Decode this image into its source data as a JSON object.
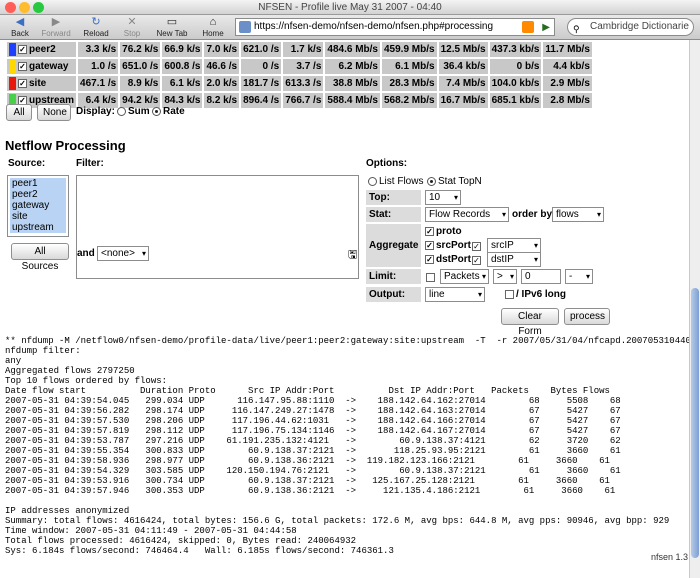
{
  "window": {
    "title": "NFSEN - Profile live May 31 2007 - 04:40"
  },
  "toolbar": {
    "back": "Back",
    "forward": "Forward",
    "reload": "Reload",
    "stop": "Stop",
    "new_tab": "New Tab",
    "home": "Home",
    "url": "https://nfsen-demo/nfsen-demo/nfsen.php#processing",
    "search_placeholder": "Cambridge Dictionarie"
  },
  "stats": [
    {
      "name": "peer2",
      "color": "#1f3fff",
      "checked": true,
      "values": [
        "3.3 k/s",
        "76.2 k/s",
        "66.9 k/s",
        "7.0 k/s",
        "621.0 /s",
        "1.7 k/s",
        "484.6 Mb/s",
        "459.9 Mb/s",
        "12.5 Mb/s",
        "437.3 kb/s",
        "11.7 Mb/s"
      ]
    },
    {
      "name": "gateway",
      "color": "#ffd800",
      "checked": true,
      "values": [
        "1.0 /s",
        "651.0 /s",
        "600.8 /s",
        "46.6 /s",
        "0 /s",
        "3.7 /s",
        "6.2 Mb/s",
        "6.1 Mb/s",
        "36.4 kb/s",
        "0 b/s",
        "4.4 kb/s"
      ]
    },
    {
      "name": "site",
      "color": "#e8190c",
      "checked": true,
      "values": [
        "467.1 /s",
        "8.9 k/s",
        "6.1 k/s",
        "2.0 k/s",
        "181.7 /s",
        "613.3 /s",
        "38.8 Mb/s",
        "28.3 Mb/s",
        "7.4 Mb/s",
        "104.0 kb/s",
        "2.9 Mb/s"
      ]
    },
    {
      "name": "upstream",
      "color": "#49d04a",
      "checked": true,
      "values": [
        "6.4 k/s",
        "94.2 k/s",
        "84.3 k/s",
        "8.2 k/s",
        "896.4 /s",
        "766.7 /s",
        "588.4 Mb/s",
        "568.2 Mb/s",
        "16.7 Mb/s",
        "685.1 kb/s",
        "2.8 Mb/s"
      ]
    }
  ],
  "controls": {
    "all": "All",
    "none": "None",
    "display_label": "Display:",
    "sum": "Sum",
    "rate": "Rate"
  },
  "processing": {
    "heading": "Netflow Processing",
    "source_label": "Source:",
    "filter_label": "Filter:",
    "options_label": "Options:",
    "sources": [
      "peer1",
      "peer2",
      "gateway",
      "site",
      "upstream"
    ],
    "all_sources": "All Sources",
    "and_label": "and",
    "and_select": "<none>",
    "list_flows": "List Flows",
    "stat_topn": "Stat TopN",
    "top_label": "Top:",
    "top_value": "10",
    "stat_label": "Stat:",
    "stat_value": "Flow Records",
    "order_by_label": "order by",
    "order_by_value": "flows",
    "aggregate_label": "Aggregate",
    "proto": "proto",
    "srcport": "srcPort",
    "srcip_sel": "srcIP",
    "dstport": "dstPort",
    "dstip_sel": "dstIP",
    "limit_label": "Limit:",
    "limit_type": "Packets",
    "limit_op": ">",
    "limit_value": "0",
    "limit_unit": "-",
    "output_label": "Output:",
    "output_value": "line",
    "ipv6": "/ IPv6 long",
    "clear_form": "Clear Form",
    "process": "process"
  },
  "output_lines": [
    "** nfdump -M /netflow0/nfsen-demo/profile-data/live/peer1:peer2:gateway:site:upstream  -T  -r 2007/05/31/04/nfcapd.200705310440",
    "nfdump filter:",
    "any",
    "Aggregated flows 2797250",
    "Top 10 flows ordered by flows:",
    "Date flow start          Duration Proto      Src IP Addr:Port          Dst IP Addr:Port   Packets    Bytes Flows",
    "2007-05-31 04:39:54.045   299.034 UDP      116.147.95.88:1110  ->    188.142.64.162:27014        68     5508    68",
    "2007-05-31 04:39:56.282   298.174 UDP     116.147.249.27:1478  ->    188.142.64.163:27014        67     5427    67",
    "2007-05-31 04:39:57.530   298.206 UDP     117.196.44.62:1031   ->    188.142.64.166:27014        67     5427    67",
    "2007-05-31 04:39:57.819   298.112 UDP     117.196.75.134:1146  ->    188.142.64.167:27014        67     5427    67",
    "2007-05-31 04:39:53.787   297.216 UDP    61.191.235.132:4121   ->        60.9.138.37:4121        62     3720    62",
    "2007-05-31 04:39:55.354   300.833 UDP        60.9.138.37:2121  ->       118.25.93.95:2121        61     3660    61",
    "2007-05-31 04:39:58.936   298.977 UDP        60.9.138.36:2121  ->  119.182.123.166:2121        61     3660    61",
    "2007-05-31 04:39:54.329   303.585 UDP    120.150.194.76:2121   ->        60.9.138.37:2121        61     3660    61",
    "2007-05-31 04:39:53.916   300.734 UDP        60.9.138.37:2121  ->   125.167.25.128:2121        61     3660    61",
    "2007-05-31 04:39:57.946   300.353 UDP        60.9.138.36:2121  ->     121.135.4.186:2121        61     3660    61",
    "",
    "IP addresses anonymized",
    "Summary: total flows: 4616424, total bytes: 156.6 G, total packets: 172.6 M, avg bps: 644.8 M, avg pps: 90946, avg bpp: 929",
    "Time window: 2007-05-31 04:11:49 - 2007-05-31 04:44:58",
    "Total flows processed: 4616424, skipped: 0, Bytes read: 240064932",
    "Sys: 6.184s flows/second: 746464.4   Wall: 6.185s flows/second: 746361.3"
  ],
  "footer": "nfsen 1.3"
}
